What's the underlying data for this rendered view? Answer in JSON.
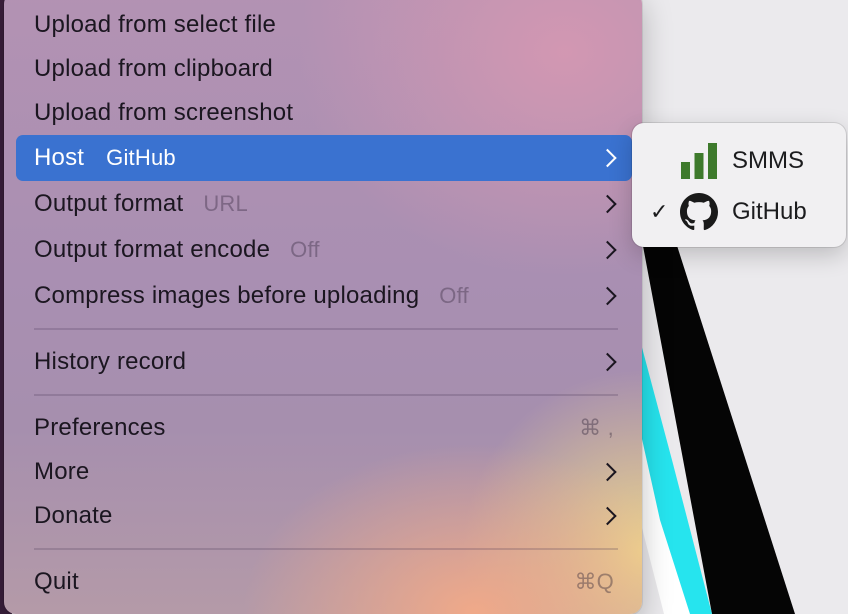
{
  "menu": {
    "items": [
      {
        "label": "Upload from select file"
      },
      {
        "label": "Upload from clipboard"
      },
      {
        "label": "Upload from screenshot"
      },
      {
        "label": "Host",
        "value": "GitHub"
      },
      {
        "label": "Output format",
        "value": "URL"
      },
      {
        "label": "Output format encode",
        "value": "Off"
      },
      {
        "label": "Compress images before uploading",
        "value": "Off"
      },
      {
        "label": "History record"
      },
      {
        "label": "Preferences",
        "shortcut": "⌘ ,"
      },
      {
        "label": "More"
      },
      {
        "label": "Donate"
      },
      {
        "label": "Quit",
        "shortcut": "⌘Q"
      }
    ]
  },
  "submenu": {
    "items": [
      {
        "label": "SMMS",
        "icon": "signal-bars-icon",
        "checked": false
      },
      {
        "label": "GitHub",
        "icon": "github-icon",
        "checked": true,
        "check_mark": "✓"
      }
    ]
  },
  "colors": {
    "highlight": "#3a72d0",
    "smms_icon": "#3e7a2c"
  }
}
